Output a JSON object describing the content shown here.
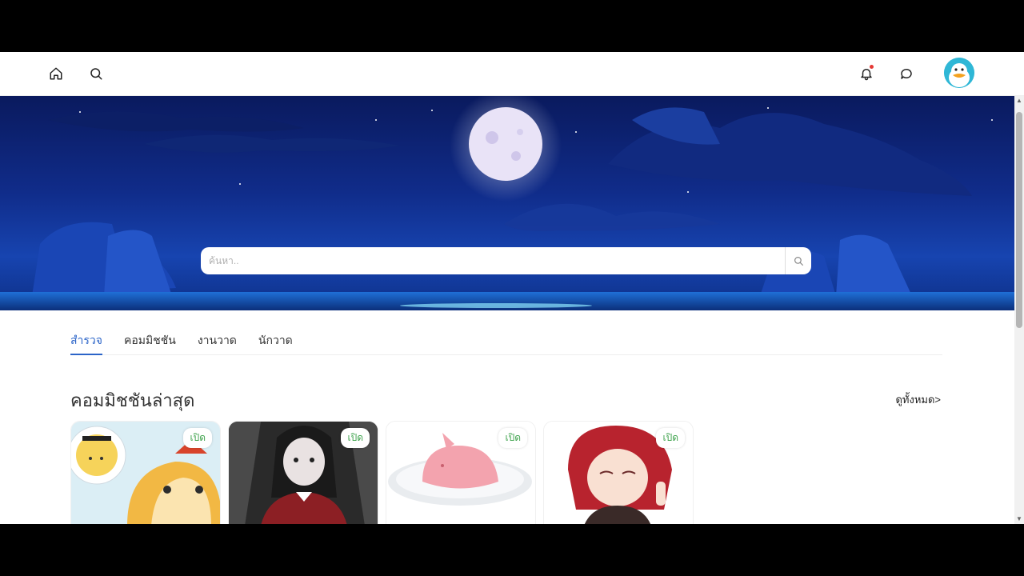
{
  "nav": {
    "home_icon": "home-icon",
    "search_icon": "search-icon",
    "bell_icon": "bell-icon",
    "chat_icon": "chat-icon"
  },
  "hero": {
    "search_placeholder": "ค้นหา..",
    "search_icon": "search-icon"
  },
  "tabs": [
    {
      "label": "สำรวจ",
      "active": true
    },
    {
      "label": "คอมมิชชัน",
      "active": false
    },
    {
      "label": "งานวาด",
      "active": false
    },
    {
      "label": "นักวาด",
      "active": false
    }
  ],
  "section": {
    "title": "คอมมิชชันล่าสุด",
    "see_all": "ดูทั้งหมด>"
  },
  "cards": [
    {
      "badge": "เปิด"
    },
    {
      "badge": "เปิด"
    },
    {
      "badge": "เปิด"
    },
    {
      "badge": "เปิด"
    }
  ],
  "colors": {
    "accent": "#2b64c8",
    "badge_text": "#3fa34d",
    "notification": "#e53935"
  }
}
